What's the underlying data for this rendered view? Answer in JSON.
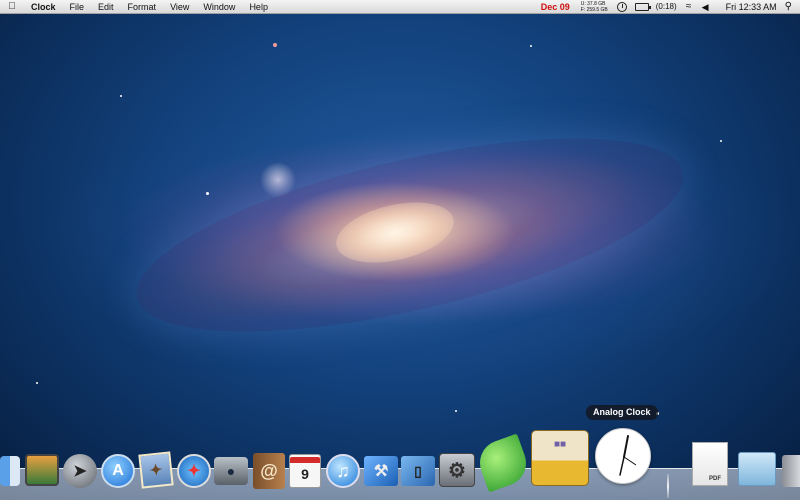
{
  "menubar": {
    "apple_icon": "apple-icon",
    "app_name": "Clock",
    "menus": [
      "File",
      "Edit",
      "Format",
      "View",
      "Window",
      "Help"
    ],
    "status_date": "Dec 09",
    "disk_used": "U: 37.8 GB",
    "disk_free": "F: 259.5 GB",
    "battery_time": "(0:18)",
    "time": "Fri 12:33 AM",
    "date_color": "#d01010"
  },
  "tooltip": {
    "text": "Analog Clock"
  },
  "dock": {
    "items": [
      {
        "name": "finder-icon",
        "label": ""
      },
      {
        "name": "photo-browser-icon",
        "label": ""
      },
      {
        "name": "launchpad-icon",
        "label": ""
      },
      {
        "name": "app-store-icon",
        "label": ""
      },
      {
        "name": "mail-icon",
        "label": ""
      },
      {
        "name": "safari-icon",
        "label": ""
      },
      {
        "name": "facetime-icon",
        "label": ""
      },
      {
        "name": "address-book-icon",
        "label": "@"
      },
      {
        "name": "calendar-icon",
        "label": "9"
      },
      {
        "name": "itunes-icon",
        "label": "♫"
      },
      {
        "name": "xcode-icon",
        "label": ""
      },
      {
        "name": "ios-simulator-icon",
        "label": ""
      },
      {
        "name": "system-preferences-icon",
        "label": ""
      },
      {
        "name": "leaf-app-icon",
        "label": ""
      },
      {
        "name": "transmit-truck-icon",
        "label": ""
      },
      {
        "name": "analog-clock-icon",
        "label": ""
      },
      {
        "name": "pdf-document-icon",
        "label": "PDF"
      },
      {
        "name": "downloads-folder-icon",
        "label": ""
      },
      {
        "name": "trash-icon",
        "label": ""
      }
    ]
  }
}
